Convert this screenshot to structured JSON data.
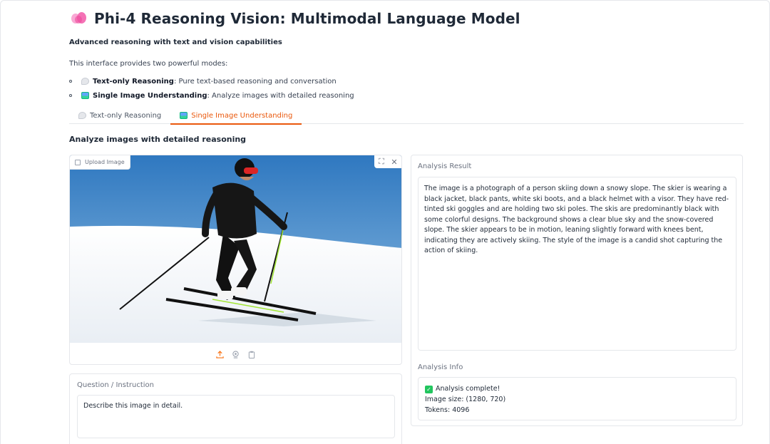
{
  "header": {
    "title": "Phi-4 Reasoning Vision: Multimodal Language Model",
    "subtitle": "Advanced reasoning with text and vision capabilities",
    "intro": "This interface provides two powerful modes:",
    "modes": [
      {
        "name": "Text-only Reasoning",
        "desc": ": Pure text-based reasoning and conversation",
        "icon": "speech-bubble-icon"
      },
      {
        "name": "Single Image Understanding",
        "desc": ": Analyze images with detailed reasoning",
        "icon": "framed-picture-icon"
      }
    ]
  },
  "tabs": [
    {
      "label": "Text-only Reasoning",
      "active": false,
      "icon": "speech-bubble-icon"
    },
    {
      "label": "Single Image Understanding",
      "active": true,
      "icon": "framed-picture-icon"
    }
  ],
  "main": {
    "heading": "Analyze images with detailed reasoning",
    "image_panel": {
      "label": "Upload Image",
      "controls": [
        "fullscreen-icon",
        "close-icon"
      ],
      "sources": [
        "upload-icon",
        "webcam-icon",
        "clipboard-icon"
      ]
    },
    "question": {
      "label": "Question / Instruction",
      "value": "Describe this image in detail."
    },
    "result": {
      "label": "Analysis Result",
      "text": "The image is a photograph of a person skiing down a snowy slope. The skier is wearing a black jacket, black pants, white ski boots, and a black helmet with a visor. They have red-tinted ski goggles and are holding two ski poles. The skis are predominantly black with some colorful designs. The background shows a clear blue sky and the snow-covered slope. The skier appears to be in motion, leaning slightly forward with knees bent, indicating they are actively skiing. The style of the image is a candid shot capturing the action of skiing."
    },
    "info": {
      "label": "Analysis Info",
      "status": "Analysis complete!",
      "image_size": "Image size: (1280, 720)",
      "tokens": "Tokens: 4096"
    }
  },
  "colors": {
    "accent": "#ea580c",
    "border": "#e5e7eb",
    "sky": "#3b82c4",
    "snow": "#f3f4f6"
  }
}
